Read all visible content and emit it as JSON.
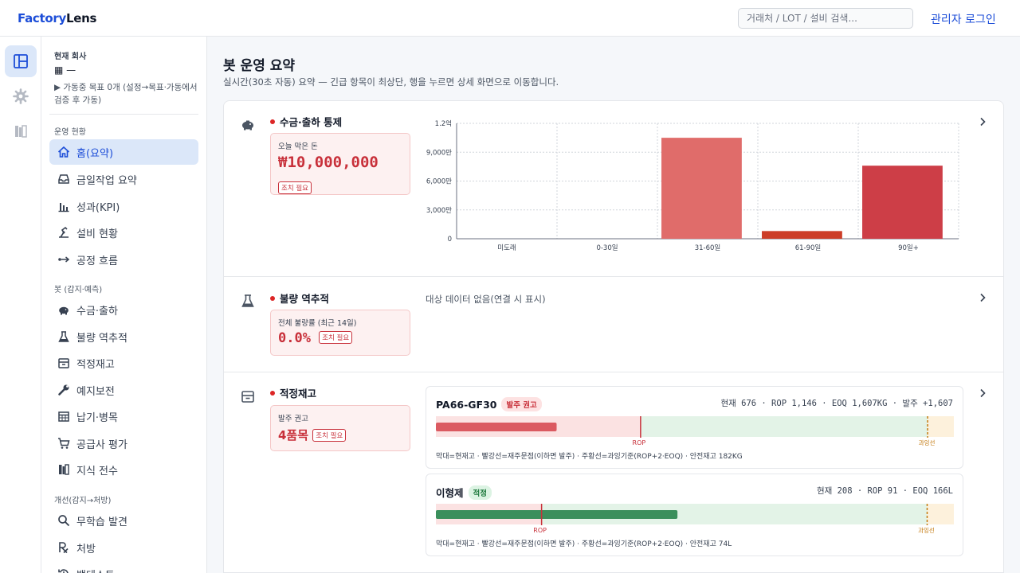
{
  "app": {
    "logo_part1": "Factory",
    "logo_part2": "Lens",
    "search_placeholder": "거래처 / LOT / 설비 검색...",
    "login_label": "관리자 로그인"
  },
  "rail": {
    "items": [
      {
        "icon": "dashboard-icon",
        "active": true
      },
      {
        "icon": "gear-icon",
        "active": false
      },
      {
        "icon": "book-icon",
        "active": false
      }
    ]
  },
  "company": {
    "label": "현재 회사",
    "name": "▦ —",
    "hint": "▶ 가동중 목표 0개 (설정→목표·가동에서 검증 후 가동)"
  },
  "sidebar": {
    "sections": [
      {
        "title": "운영 현황",
        "items": [
          {
            "label": "홈(요약)",
            "icon": "home-icon",
            "active": true
          },
          {
            "label": "금일작업 요약",
            "icon": "inbox-icon"
          },
          {
            "label": "성과(KPI)",
            "icon": "bar-chart-icon"
          },
          {
            "label": "설비 현황",
            "icon": "machine-icon"
          },
          {
            "label": "공정 흐름",
            "icon": "flow-icon"
          }
        ]
      },
      {
        "title": "봇 (감지·예측)",
        "items": [
          {
            "label": "수금·출하",
            "icon": "piggy-bank-icon"
          },
          {
            "label": "불량 역추적",
            "icon": "flask-icon"
          },
          {
            "label": "적정재고",
            "icon": "box-icon"
          },
          {
            "label": "예지보전",
            "icon": "wrench-icon"
          },
          {
            "label": "납기·병목",
            "icon": "calendar-icon"
          },
          {
            "label": "공급사 평가",
            "icon": "cart-icon"
          },
          {
            "label": "지식 전수",
            "icon": "book-icon"
          }
        ]
      },
      {
        "title": "개선(감지→처방)",
        "items": [
          {
            "label": "무학습 발견",
            "icon": "search-icon"
          },
          {
            "label": "처방",
            "icon": "rx-icon"
          },
          {
            "label": "백테스트",
            "icon": "history-icon"
          }
        ]
      }
    ]
  },
  "page": {
    "title": "봇 운영 요약",
    "subtitle": "실시간(30초 자동) 요약 — 긴급 항목이 최상단, 행을 누르면 상세 화면으로 이동합니다."
  },
  "cards": {
    "collection": {
      "title": "수금·출하 통제",
      "kpi_label": "오늘 막은 돈",
      "kpi_value": "₩10,000,000",
      "badge": "조치 필요"
    },
    "defect": {
      "title": "불량 역추적",
      "kpi_label": "전체 불량률 (최근 14일)",
      "kpi_value": "0.0%",
      "badge": "조치 필요",
      "empty_text": "대상 데이터 없음(연결 시 표시)"
    },
    "inventory": {
      "title": "적정재고",
      "kpi_label": "발주 권고",
      "kpi_value": "4품목",
      "badge": "조치 필요",
      "items": [
        {
          "name": "PA66-GF30",
          "tag": "발주 권고",
          "stats": "현재 676 · ROP 1,146 · EOQ 1,607KG · 발주 +1,607",
          "current": 676,
          "rop": 1146,
          "over": 2753,
          "max": 2900,
          "rop_label": "ROP",
          "over_label": "과잉선",
          "legend": "막대=현재고 · 빨강선=재주문점(이하면 발주) · 주황선=과잉기준(ROP+2·EOQ) · 안전재고 182KG"
        },
        {
          "name": "이형제",
          "tag": "적정",
          "stats": "현재 208 · ROP 91 · EOQ 166L",
          "current": 208,
          "rop": 91,
          "over": 423,
          "max": 446,
          "rop_label": "ROP",
          "over_label": "과잉선",
          "legend": "막대=현재고 · 빨강선=재주문점(이하면 발주) · 주황선=과잉기준(ROP+2·EOQ) · 안전재고 74L"
        }
      ]
    }
  },
  "chart_data": {
    "type": "bar",
    "categories": [
      "미도래",
      "0-30일",
      "31-60일",
      "61-90일",
      "90일+"
    ],
    "values": [
      0,
      0,
      105000000,
      8000000,
      76000000
    ],
    "colors": [
      "#e06c6a",
      "#e06c6a",
      "#e06c6a",
      "#cc3d28",
      "#cd3e47"
    ],
    "yticks": [
      0,
      30000000,
      60000000,
      90000000,
      120000000
    ],
    "ytick_labels": [
      "0",
      "3,000만",
      "6,000만",
      "9,000만",
      "1.2억"
    ],
    "ylim": [
      0,
      120000000
    ],
    "grid": true
  }
}
